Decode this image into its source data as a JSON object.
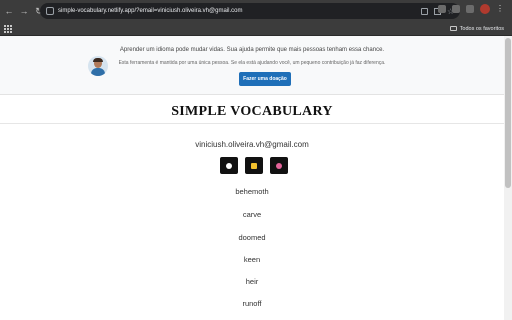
{
  "browser": {
    "url": "simple-vocabulary.netlify.app/?email=viniciush.oliveira.vh@gmail.com",
    "bookmarks_folder": "Todos os favoritos"
  },
  "donation": {
    "line1": "Aprender um idioma pode mudar vidas. Sua ajuda permite que mais pessoas tenham essa chance.",
    "line2": "Esta ferramenta é mantida por uma única pessoa. Se ela está ajudando você, um pequeno contribuição já faz diferença.",
    "button_label": "Fazer uma doação"
  },
  "page": {
    "title": "SIMPLE VOCABULARY",
    "email": "viniciush.oliveira.vh@gmail.com"
  },
  "theme_buttons": [
    {
      "name": "theme-white",
      "color": "#ffffff"
    },
    {
      "name": "theme-yellow",
      "color": "#f2c12e"
    },
    {
      "name": "theme-pink",
      "color": "#e5649a"
    }
  ],
  "words": [
    "behemoth",
    "carve",
    "doomed",
    "keen",
    "heir",
    "runoff"
  ],
  "colors": {
    "browser_bar": "#3c3c3c",
    "donate_button": "#1f6fb8",
    "theme_button_bg": "#111111"
  }
}
